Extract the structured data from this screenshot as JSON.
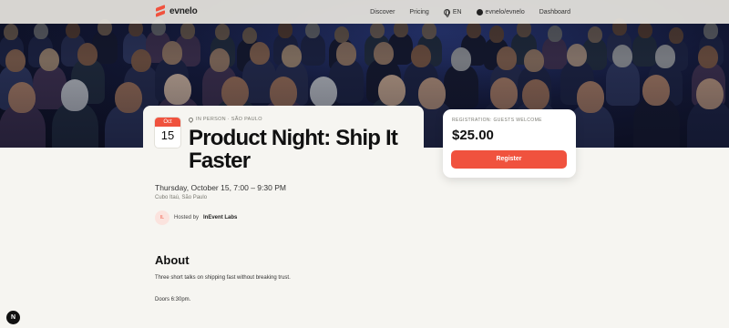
{
  "brand": {
    "name": "evnelo",
    "accent": "#f0523e"
  },
  "nav": {
    "discover": "Discover",
    "pricing": "Pricing",
    "language": "EN",
    "repo": "evnelo/evnelo",
    "dashboard": "Dashboard"
  },
  "hero": {
    "image": "audience-crowd-photo"
  },
  "event": {
    "month": "Oct",
    "day": "15",
    "location_tag": "IN PERSON · SÃO PAULO",
    "title": "Product Night: Ship It Faster",
    "when": "Thursday, October 15, 7:00 – 9:30 PM",
    "where": "Cubo Itaú, São Paulo",
    "host_initials": "IL",
    "host_prefix": "Hosted by",
    "host_name": "InEvent Labs"
  },
  "about": {
    "heading": "About",
    "paragraph1": "Three short talks on shipping fast without breaking trust.",
    "paragraph2": "Doors 6:30pm."
  },
  "registration": {
    "label": "REGISTRATION: GUESTS WELCOME",
    "price": "$25.00",
    "button": "Register"
  },
  "dev_badge": "N"
}
